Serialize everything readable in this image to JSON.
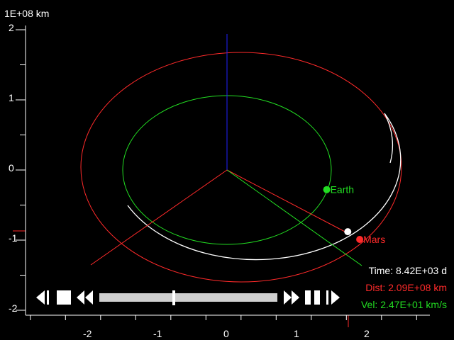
{
  "axes": {
    "scale_label": "1E+08 km",
    "x_ticks": [
      {
        "value": -2,
        "label": "-2"
      },
      {
        "value": -1,
        "label": "-1"
      },
      {
        "value": 0,
        "label": "0"
      },
      {
        "value": 1,
        "label": "1"
      },
      {
        "value": 2,
        "label": "2"
      }
    ],
    "y_ticks": [
      {
        "value": 2,
        "label": "2"
      },
      {
        "value": 1,
        "label": "1"
      },
      {
        "value": 0,
        "label": "0"
      },
      {
        "value": -1,
        "label": "-1"
      },
      {
        "value": -2,
        "label": "-2"
      }
    ],
    "axis_color": "#ffffff"
  },
  "bodies": {
    "earth": {
      "label": "Earth",
      "color": "#22dd22",
      "x": 1.42,
      "y": -0.28
    },
    "mars": {
      "label": "Mars",
      "color": "#ff2a2a",
      "x": 1.89,
      "y": -0.99
    },
    "spacecraft": {
      "color": "#ffffff",
      "x": 1.72,
      "y": -0.88
    }
  },
  "orbit_colors": {
    "earth": "#22dd22",
    "mars": "#ff2a2a",
    "transfer": "#ffffff",
    "z_axis": "#2020ff"
  },
  "readouts": {
    "time": "Time: 8.42E+03 d",
    "dist": "Dist: 2.09E+08 km",
    "vel": "Vel: 2.47E+01 km/s"
  },
  "playback": {
    "position": 0.42,
    "controls": [
      "step-back-icon",
      "stop-icon",
      "rewind-icon",
      "fast-forward-icon",
      "pause-icon",
      "step-forward-icon"
    ]
  }
}
